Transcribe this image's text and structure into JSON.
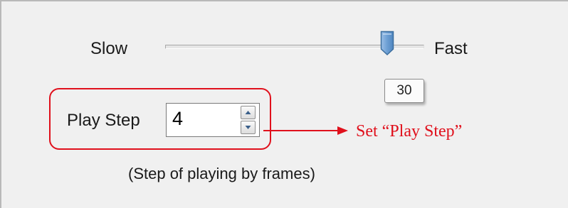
{
  "speed_slider": {
    "min_label": "Slow",
    "max_label": "Fast",
    "value": "30",
    "position_fraction": 0.85
  },
  "play_step": {
    "label": "Play Step",
    "value": "4",
    "caption": "(Step of playing by frames)"
  },
  "annotation": {
    "text": "Set “Play Step”",
    "color": "#e0101c"
  },
  "icons": {
    "spin_up": "triangle-up-icon",
    "spin_down": "triangle-down-icon",
    "thumb": "slider-thumb-icon",
    "arrow": "arrow-right-icon"
  }
}
